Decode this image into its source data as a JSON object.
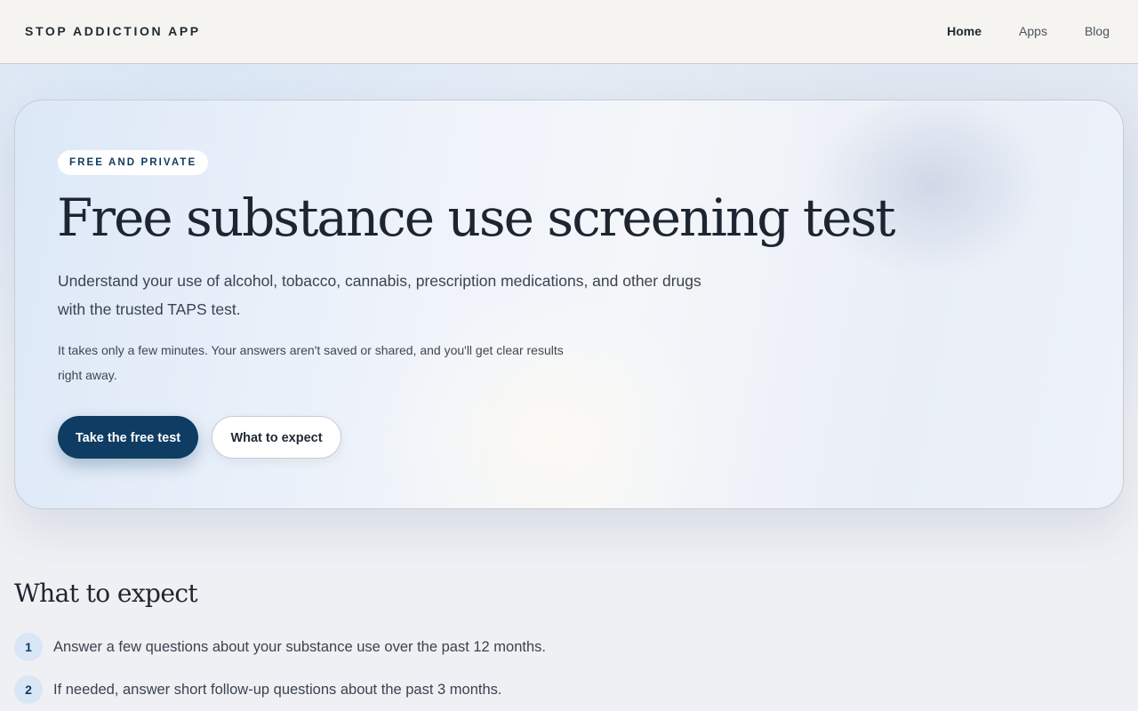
{
  "header": {
    "brand": "STOP ADDICTION APP",
    "nav": [
      {
        "label": "Home",
        "active": true
      },
      {
        "label": "Apps",
        "active": false
      },
      {
        "label": "Blog",
        "active": false
      }
    ]
  },
  "hero": {
    "badge": "FREE AND PRIVATE",
    "title": "Free substance use screening test",
    "lead": "Understand your use of alcohol, tobacco, cannabis, prescription medications, and other drugs with the trusted TAPS test.",
    "note": "It takes only a few minutes. Your answers aren't saved or shared, and you'll get clear results right away.",
    "primary_button": "Take the free test",
    "secondary_button": "What to expect"
  },
  "expect": {
    "title": "What to expect",
    "steps": [
      {
        "number": "1",
        "text": "Answer a few questions about your substance use over the past 12 months."
      },
      {
        "number": "2",
        "text": "If needed, answer short follow-up questions about the past 3 months."
      }
    ]
  },
  "colors": {
    "accent": "#0e3c63",
    "header_bg": "#f5f4f1",
    "step_badge_bg": "#d8e6f6"
  }
}
